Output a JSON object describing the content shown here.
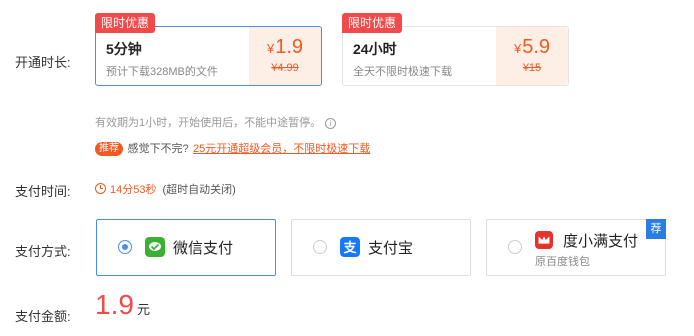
{
  "duration": {
    "label": "开通时长:",
    "plans": [
      {
        "badge": "限时优惠",
        "name": "5分钟",
        "desc": "预计下载328MB的文件",
        "price": "1.9",
        "original": "¥4.99",
        "selected": true
      },
      {
        "badge": "限时优惠",
        "name": "24小时",
        "desc": "全天不限时极速下载",
        "price": "5.9",
        "original": "¥15",
        "selected": false
      }
    ],
    "currency_symbol": "¥",
    "validity_note": "有效期为1小时，开始使用后，不能中途暂停。",
    "promo": {
      "badge": "推荐",
      "text": "感觉下不完?",
      "link": "25元开通超级会员，不限时极速下载"
    }
  },
  "pay_time": {
    "label": "支付时间:",
    "countdown": "14分53秒",
    "note": "(超时自动关闭)"
  },
  "pay_method": {
    "label": "支付方式:",
    "options": [
      {
        "name": "微信支付",
        "icon": "wechat-pay-icon",
        "selected": true,
        "color": "#3cb034"
      },
      {
        "name": "支付宝",
        "icon": "alipay-icon",
        "selected": false,
        "color": "#1677ff"
      },
      {
        "name": "度小满支付",
        "sub": "原百度钱包",
        "icon": "duxiaoman-icon",
        "selected": false,
        "badge": "荐",
        "color": "#e8322d"
      }
    ]
  },
  "amount": {
    "label": "支付金额:",
    "value": "1.9",
    "unit": "元"
  },
  "colors": {
    "accent": "#f05a22",
    "badge_red": "#f04a4a",
    "select_blue": "#4b8eea"
  }
}
